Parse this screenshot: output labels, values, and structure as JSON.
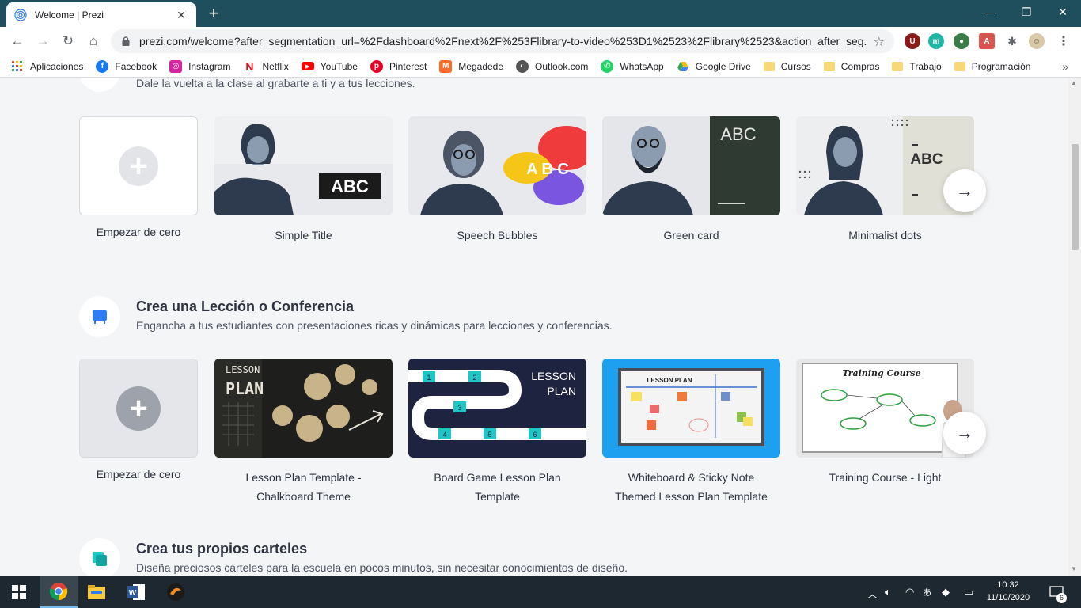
{
  "browser": {
    "tab_title": "Welcome | Prezi",
    "url": "prezi.com/welcome?after_segmentation_url=%2Fdashboard%2Fnext%2F%253Flibrary-to-video%253D1%2523%2Flibrary%2523&action_after_seg...",
    "bookmarks": [
      {
        "label": "Aplicaciones",
        "icon": "apps-grid-icon"
      },
      {
        "label": "Facebook",
        "icon": "facebook-icon",
        "color": "#1877f2"
      },
      {
        "label": "Instagram",
        "icon": "instagram-icon",
        "color": "#d6249f"
      },
      {
        "label": "Netflix",
        "icon": "netflix-icon",
        "color": "#e50914"
      },
      {
        "label": "YouTube",
        "icon": "youtube-icon",
        "color": "#ff0000"
      },
      {
        "label": "Pinterest",
        "icon": "pinterest-icon",
        "color": "#e60023"
      },
      {
        "label": "Megadede",
        "icon": "megadede-icon",
        "color": "#ff6a2b"
      },
      {
        "label": "Outlook.com",
        "icon": "outlook-icon",
        "color": "#555555"
      },
      {
        "label": "WhatsApp",
        "icon": "whatsapp-icon",
        "color": "#25d366"
      },
      {
        "label": "Google Drive",
        "icon": "drive-icon",
        "color": "#34a853"
      },
      {
        "label": "Cursos",
        "icon": "folder-icon"
      },
      {
        "label": "Compras",
        "icon": "folder-icon"
      },
      {
        "label": "Trabajo",
        "icon": "folder-icon"
      },
      {
        "label": "Programación",
        "icon": "folder-icon"
      }
    ]
  },
  "sections": {
    "video": {
      "subtitle": "Dale la vuelta a la clase al grabarte a ti y a tus lecciones.",
      "blank_label": "Empezar de cero",
      "cards": [
        {
          "label": "Simple Title",
          "art_text": "ABC"
        },
        {
          "label": "Speech Bubbles",
          "art_text": "A B C"
        },
        {
          "label": "Green card",
          "art_text": "ABC"
        },
        {
          "label": "Minimalist dots",
          "art_text": "ABC"
        }
      ]
    },
    "lesson": {
      "title": "Crea una Lección o Conferencia",
      "subtitle": "Engancha a tus estudiantes con presentaciones ricas y dinámicas para lecciones y conferencias.",
      "blank_label": "Empezar de cero",
      "cards": [
        {
          "label_1": "Lesson Plan Template -",
          "label_2": "Chalkboard Theme",
          "art_text_1": "LESSON",
          "art_text_2": "PLAN"
        },
        {
          "label_1": "Board Game Lesson Plan",
          "label_2": "Template",
          "art_text_1": "LESSON",
          "art_text_2": "PLAN",
          "squares": [
            "1",
            "2",
            "3",
            "4",
            "5",
            "6"
          ]
        },
        {
          "label_1": "Whiteboard & Sticky Note",
          "label_2": "Themed Lesson Plan Template",
          "art_text_1": "LESSON PLAN"
        },
        {
          "label_1": "Training Course - Light",
          "label_2": "",
          "art_text_1": "Training Course"
        }
      ]
    },
    "posters": {
      "title": "Crea tus propios carteles",
      "subtitle": "Diseña preciosos carteles para la escuela en pocos minutos, sin necesitar conocimientos de diseño."
    }
  },
  "taskbar": {
    "time": "10:32",
    "date": "11/10/2020",
    "notifications": "6"
  },
  "colors": {
    "tabstrip": "#1f4e5c",
    "accent_blue": "#2e7cf6",
    "accent_teal": "#1fc6c6"
  }
}
